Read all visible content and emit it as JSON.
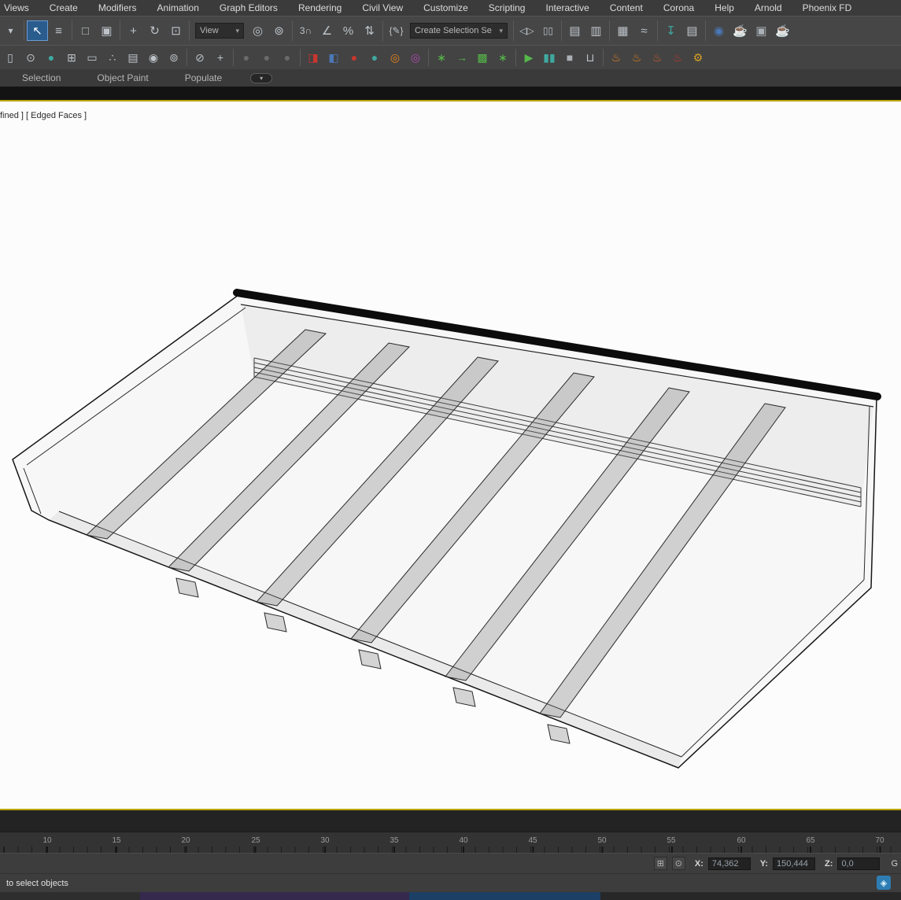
{
  "menu": {
    "items": [
      "Views",
      "Create",
      "Modifiers",
      "Animation",
      "Graph Editors",
      "Rendering",
      "Civil View",
      "Customize",
      "Scripting",
      "Interactive",
      "Content",
      "Corona",
      "Help",
      "Arnold",
      "Phoenix FD"
    ]
  },
  "toolbar": {
    "view_dropdown": "View",
    "selection_set_dropdown": "Create Selection Se"
  },
  "icons": {
    "overflow": "▾",
    "select_object": "↖",
    "select_by_name": "≡",
    "rect_region": "□",
    "window_crossing": "▣",
    "select_move": "+",
    "select_rotate": "↻",
    "select_scale": "⊡",
    "pivot_center": "◎",
    "select_manipulate": "⊚",
    "snap_toggle": "3∩",
    "angle_snap": "∠",
    "percent_snap": "%",
    "spinner_snap": "⇅",
    "named_sets": "{✎}",
    "mirror": "◁▷",
    "align": "▯▯",
    "layer_explorer": "▤",
    "scene_explorer": "▥",
    "ribbon_toggle": "▦",
    "curve_editor": "≈",
    "import_arrow": "↧",
    "asset_tracking": "▤",
    "material_editor": "◉",
    "render_setup": "☕",
    "rendered_frame": "▣",
    "render_production": "☕",
    "isolate": "▯",
    "dot_circle": "⊙",
    "sphere": "●",
    "add_box": "⊞",
    "monitor": "▭",
    "populate": "∴",
    "panel": "▤",
    "eye": "◉",
    "lamp": "⊚",
    "slice": "⊘",
    "plus": "+",
    "dot": "●",
    "cube_a": "◨",
    "cube_b": "◧",
    "arnold": "●",
    "drop": "●",
    "ring": "◎",
    "flower": "∗",
    "arrow_right": "→",
    "checker": "▩",
    "burst": "∗",
    "play": "▶",
    "pause": "▮▮",
    "stop": "■",
    "trash": "⊔",
    "flame": "♨",
    "gear": "⚙",
    "abs_mode": "⊞",
    "lock": "⊙",
    "notify": "◈",
    "caret": "▾"
  },
  "ribbon": {
    "tabs": [
      "Selection",
      "Object Paint",
      "Populate"
    ]
  },
  "viewport": {
    "label": "fined ] [ Edged Faces ]"
  },
  "timeline": {
    "ticks": [
      "10",
      "15",
      "20",
      "25",
      "30",
      "35",
      "40",
      "45",
      "50",
      "55",
      "60",
      "65",
      "70"
    ]
  },
  "status": {
    "prompt": "to select objects",
    "x_label": "X:",
    "x_value": "74,362",
    "y_label": "Y:",
    "y_value": "150,444",
    "z_label": "Z:",
    "z_value": "0,0",
    "grid_label": "G"
  }
}
